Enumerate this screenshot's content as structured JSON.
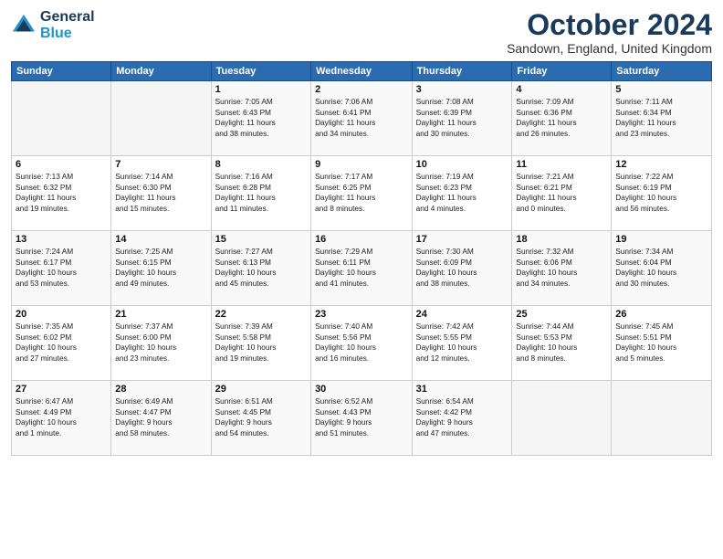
{
  "logo": {
    "line1": "General",
    "line2": "Blue"
  },
  "header": {
    "title": "October 2024",
    "location": "Sandown, England, United Kingdom"
  },
  "weekdays": [
    "Sunday",
    "Monday",
    "Tuesday",
    "Wednesday",
    "Thursday",
    "Friday",
    "Saturday"
  ],
  "weeks": [
    [
      {
        "day": "",
        "info": ""
      },
      {
        "day": "",
        "info": ""
      },
      {
        "day": "1",
        "info": "Sunrise: 7:05 AM\nSunset: 6:43 PM\nDaylight: 11 hours\nand 38 minutes."
      },
      {
        "day": "2",
        "info": "Sunrise: 7:06 AM\nSunset: 6:41 PM\nDaylight: 11 hours\nand 34 minutes."
      },
      {
        "day": "3",
        "info": "Sunrise: 7:08 AM\nSunset: 6:39 PM\nDaylight: 11 hours\nand 30 minutes."
      },
      {
        "day": "4",
        "info": "Sunrise: 7:09 AM\nSunset: 6:36 PM\nDaylight: 11 hours\nand 26 minutes."
      },
      {
        "day": "5",
        "info": "Sunrise: 7:11 AM\nSunset: 6:34 PM\nDaylight: 11 hours\nand 23 minutes."
      }
    ],
    [
      {
        "day": "6",
        "info": "Sunrise: 7:13 AM\nSunset: 6:32 PM\nDaylight: 11 hours\nand 19 minutes."
      },
      {
        "day": "7",
        "info": "Sunrise: 7:14 AM\nSunset: 6:30 PM\nDaylight: 11 hours\nand 15 minutes."
      },
      {
        "day": "8",
        "info": "Sunrise: 7:16 AM\nSunset: 6:28 PM\nDaylight: 11 hours\nand 11 minutes."
      },
      {
        "day": "9",
        "info": "Sunrise: 7:17 AM\nSunset: 6:25 PM\nDaylight: 11 hours\nand 8 minutes."
      },
      {
        "day": "10",
        "info": "Sunrise: 7:19 AM\nSunset: 6:23 PM\nDaylight: 11 hours\nand 4 minutes."
      },
      {
        "day": "11",
        "info": "Sunrise: 7:21 AM\nSunset: 6:21 PM\nDaylight: 11 hours\nand 0 minutes."
      },
      {
        "day": "12",
        "info": "Sunrise: 7:22 AM\nSunset: 6:19 PM\nDaylight: 10 hours\nand 56 minutes."
      }
    ],
    [
      {
        "day": "13",
        "info": "Sunrise: 7:24 AM\nSunset: 6:17 PM\nDaylight: 10 hours\nand 53 minutes."
      },
      {
        "day": "14",
        "info": "Sunrise: 7:25 AM\nSunset: 6:15 PM\nDaylight: 10 hours\nand 49 minutes."
      },
      {
        "day": "15",
        "info": "Sunrise: 7:27 AM\nSunset: 6:13 PM\nDaylight: 10 hours\nand 45 minutes."
      },
      {
        "day": "16",
        "info": "Sunrise: 7:29 AM\nSunset: 6:11 PM\nDaylight: 10 hours\nand 41 minutes."
      },
      {
        "day": "17",
        "info": "Sunrise: 7:30 AM\nSunset: 6:09 PM\nDaylight: 10 hours\nand 38 minutes."
      },
      {
        "day": "18",
        "info": "Sunrise: 7:32 AM\nSunset: 6:06 PM\nDaylight: 10 hours\nand 34 minutes."
      },
      {
        "day": "19",
        "info": "Sunrise: 7:34 AM\nSunset: 6:04 PM\nDaylight: 10 hours\nand 30 minutes."
      }
    ],
    [
      {
        "day": "20",
        "info": "Sunrise: 7:35 AM\nSunset: 6:02 PM\nDaylight: 10 hours\nand 27 minutes."
      },
      {
        "day": "21",
        "info": "Sunrise: 7:37 AM\nSunset: 6:00 PM\nDaylight: 10 hours\nand 23 minutes."
      },
      {
        "day": "22",
        "info": "Sunrise: 7:39 AM\nSunset: 5:58 PM\nDaylight: 10 hours\nand 19 minutes."
      },
      {
        "day": "23",
        "info": "Sunrise: 7:40 AM\nSunset: 5:56 PM\nDaylight: 10 hours\nand 16 minutes."
      },
      {
        "day": "24",
        "info": "Sunrise: 7:42 AM\nSunset: 5:55 PM\nDaylight: 10 hours\nand 12 minutes."
      },
      {
        "day": "25",
        "info": "Sunrise: 7:44 AM\nSunset: 5:53 PM\nDaylight: 10 hours\nand 8 minutes."
      },
      {
        "day": "26",
        "info": "Sunrise: 7:45 AM\nSunset: 5:51 PM\nDaylight: 10 hours\nand 5 minutes."
      }
    ],
    [
      {
        "day": "27",
        "info": "Sunrise: 6:47 AM\nSunset: 4:49 PM\nDaylight: 10 hours\nand 1 minute."
      },
      {
        "day": "28",
        "info": "Sunrise: 6:49 AM\nSunset: 4:47 PM\nDaylight: 9 hours\nand 58 minutes."
      },
      {
        "day": "29",
        "info": "Sunrise: 6:51 AM\nSunset: 4:45 PM\nDaylight: 9 hours\nand 54 minutes."
      },
      {
        "day": "30",
        "info": "Sunrise: 6:52 AM\nSunset: 4:43 PM\nDaylight: 9 hours\nand 51 minutes."
      },
      {
        "day": "31",
        "info": "Sunrise: 6:54 AM\nSunset: 4:42 PM\nDaylight: 9 hours\nand 47 minutes."
      },
      {
        "day": "",
        "info": ""
      },
      {
        "day": "",
        "info": ""
      }
    ]
  ]
}
